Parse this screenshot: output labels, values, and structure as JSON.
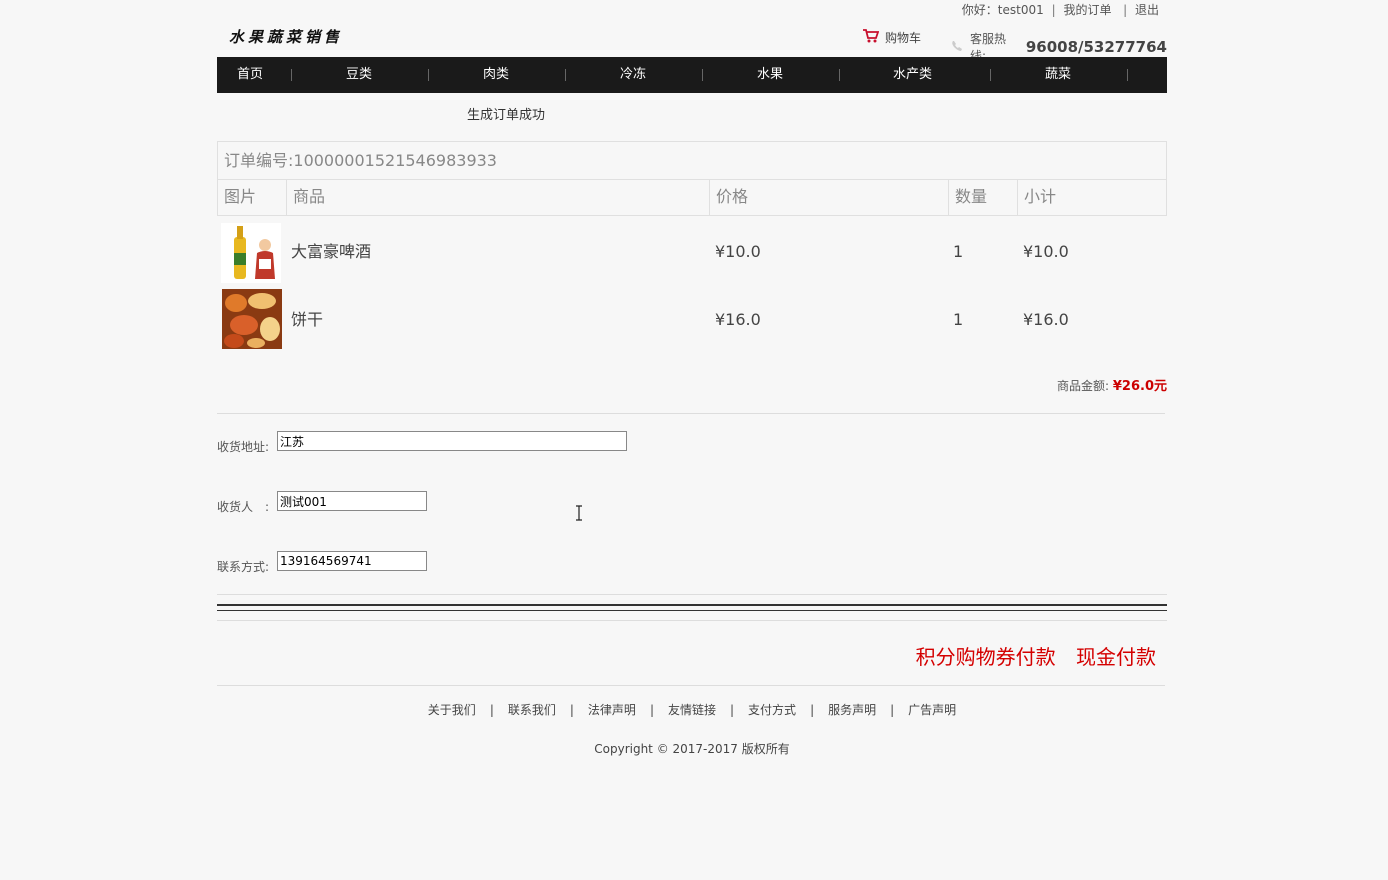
{
  "header": {
    "greeting": "你好：test001",
    "my_orders": "我的订单",
    "logout": "退出",
    "logo_text": "水果蔬菜销售",
    "cart_label": "购物车",
    "hotline_label": "客服热线:",
    "hotline_number": "96008/53277764",
    "cart_icon": "cart-icon",
    "phone_icon": "phone-icon"
  },
  "nav": {
    "items": [
      {
        "label": "首页"
      },
      {
        "label": "豆类"
      },
      {
        "label": "肉类"
      },
      {
        "label": "冷冻"
      },
      {
        "label": "水果"
      },
      {
        "label": "水产类"
      },
      {
        "label": "蔬菜"
      }
    ]
  },
  "status_message": "生成订单成功",
  "order": {
    "number_label": "订单编号:10000001521546983933",
    "columns": [
      "图片",
      "商品",
      "价格",
      "数量",
      "小计"
    ],
    "items": [
      {
        "name": "大富豪啤酒",
        "price": "¥10.0",
        "qty": "1",
        "subtotal": "¥10.0"
      },
      {
        "name": "饼干",
        "price": "¥16.0",
        "qty": "1",
        "subtotal": "¥16.0"
      }
    ],
    "total_label": "商品金额:",
    "total_value": "¥26.0元"
  },
  "form": {
    "address_label": "收货地址:",
    "address_value": "江苏",
    "receiver_label": "收货人　:",
    "receiver_value": "测试001",
    "phone_label": "联系方式:",
    "phone_value": "139164569741"
  },
  "payment": {
    "points_voucher": "积分购物券付款",
    "cash": "现金付款"
  },
  "footer": {
    "links": [
      "关于我们",
      "联系我们",
      "法律声明",
      "友情链接",
      "支付方式",
      "服务声明",
      "广告声明"
    ],
    "copyright": "Copyright © 2017-2017 版权所有"
  },
  "colors": {
    "nav_bg": "#1a1a1a",
    "accent_red": "#d40000",
    "total_red": "#cc0000"
  }
}
